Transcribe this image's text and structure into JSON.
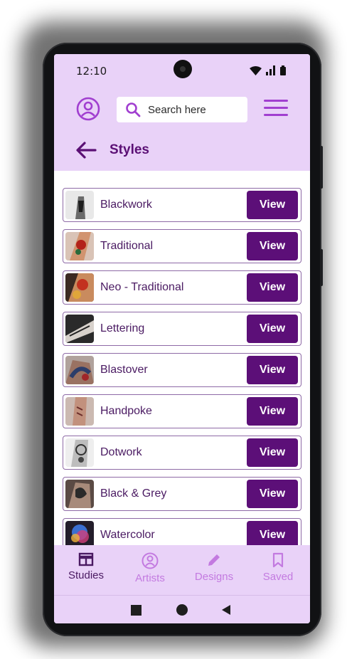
{
  "status_bar": {
    "time": "12:10"
  },
  "header": {
    "search_placeholder": "Search here",
    "page_title": "Styles"
  },
  "styles": [
    {
      "label": "Blackwork",
      "button": "View"
    },
    {
      "label": "Traditional",
      "button": "View"
    },
    {
      "label": "Neo - Traditional",
      "button": "View"
    },
    {
      "label": "Lettering",
      "button": "View"
    },
    {
      "label": "Blastover",
      "button": "View"
    },
    {
      "label": "Handpoke",
      "button": "View"
    },
    {
      "label": "Dotwork",
      "button": "View"
    },
    {
      "label": "Black & Grey",
      "button": "View"
    },
    {
      "label": "Watercolor",
      "button": "View"
    }
  ],
  "bottom_nav": [
    {
      "label": "Studies",
      "icon": "store-icon",
      "active": true
    },
    {
      "label": "Artists",
      "icon": "person-icon",
      "active": false
    },
    {
      "label": "Designs",
      "icon": "pencil-icon",
      "active": false
    },
    {
      "label": "Saved",
      "icon": "bookmark-icon",
      "active": false
    }
  ],
  "colors": {
    "header_bg": "#e9d2f8",
    "accent": "#5c0f78",
    "icon_accent": "#a13fd0",
    "inactive_nav": "#c37ae0"
  }
}
